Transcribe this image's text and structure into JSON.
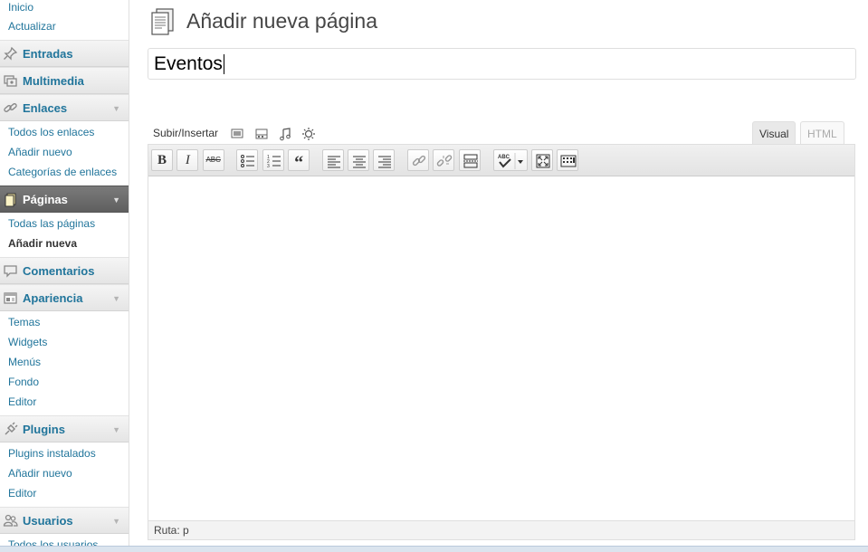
{
  "sidebar": {
    "top_links": [
      {
        "label": "Inicio"
      },
      {
        "label": "Actualizar"
      }
    ],
    "menus": [
      {
        "label": "Entradas",
        "icon": "pin-icon",
        "has_submenu": false
      },
      {
        "label": "Multimedia",
        "icon": "media-icon",
        "has_submenu": false
      },
      {
        "label": "Enlaces",
        "icon": "link-icon",
        "has_submenu": true,
        "items": [
          "Todos los enlaces",
          "Añadir nuevo",
          "Categorías de enlaces"
        ]
      },
      {
        "label": "Páginas",
        "icon": "pages-icon",
        "has_submenu": true,
        "active": true,
        "items": [
          "Todas las páginas",
          "Añadir nueva"
        ],
        "current_item": "Añadir nueva"
      },
      {
        "label": "Comentarios",
        "icon": "comment-icon",
        "has_submenu": false
      },
      {
        "label": "Apariencia",
        "icon": "appearance-icon",
        "has_submenu": true,
        "items": [
          "Temas",
          "Widgets",
          "Menús",
          "Fondo",
          "Editor"
        ]
      },
      {
        "label": "Plugins",
        "icon": "plugin-icon",
        "has_submenu": true,
        "items": [
          "Plugins instalados",
          "Añadir nuevo",
          "Editor"
        ]
      },
      {
        "label": "Usuarios",
        "icon": "users-icon",
        "has_submenu": true,
        "items": [
          "Todos los usuarios"
        ]
      }
    ],
    "arrow": "▼"
  },
  "main": {
    "page_title": "Añadir nueva página",
    "title_value": "Eventos",
    "media_label": "Subir/Insertar",
    "tabs": {
      "visual": "Visual",
      "html": "HTML"
    },
    "toolbar": {
      "bold": "B",
      "italic": "I",
      "strike": "ABC",
      "quote": "“"
    },
    "status_path": "Ruta: p"
  },
  "colors": {
    "link": "#21759b",
    "active_menu": "#6d6d6d"
  }
}
